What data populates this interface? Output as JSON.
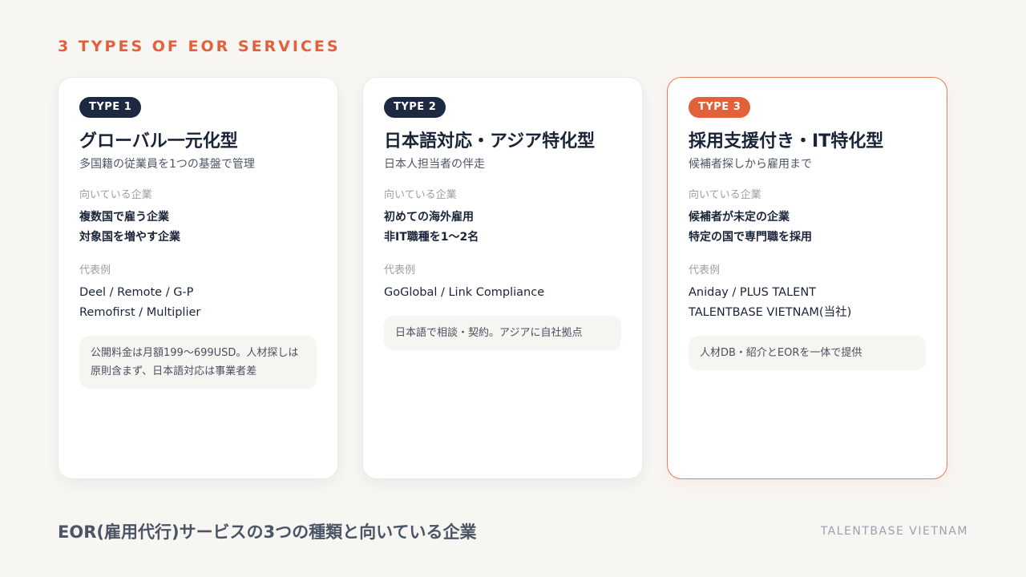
{
  "header": {
    "eyebrow": "3 TYPES OF EOR SERVICES"
  },
  "cards": [
    {
      "badge": "TYPE 1",
      "title": "グローバル一元化型",
      "subtitle": "多国籍の従業員を1つの基盤で管理",
      "fit_label": "向いている企業",
      "fit_items": [
        "複数国で雇う企業",
        "対象国を増やす企業"
      ],
      "examples_label": "代表例",
      "examples": [
        "Deel / Remote / G-P",
        "Remofirst / Multiplier"
      ],
      "note_lines": [
        "公開料金は月額199〜699USD。人材探しは",
        "原則含まず、日本語対応は事業者差"
      ]
    },
    {
      "badge": "TYPE 2",
      "title": "日本語対応・アジア特化型",
      "subtitle": "日本人担当者の伴走",
      "fit_label": "向いている企業",
      "fit_items": [
        "初めての海外雇用",
        "非IT職種を1〜2名"
      ],
      "examples_label": "代表例",
      "examples": [
        "GoGlobal / Link Compliance"
      ],
      "note_lines": [
        "日本語で相談・契約。アジアに自社拠点"
      ]
    },
    {
      "badge": "TYPE 3",
      "title": "採用支援付き・IT特化型",
      "subtitle": "候補者探しから雇用まで",
      "fit_label": "向いている企業",
      "fit_items": [
        "候補者が未定の企業",
        "特定の国で専門職を採用"
      ],
      "examples_label": "代表例",
      "examples": [
        "Aniday / PLUS TALENT",
        "TALENTBASE VIETNAM(当社)"
      ],
      "note_lines": [
        "人材DB・紹介とEORを一体で提供"
      ]
    }
  ],
  "footer": {
    "title": "EOR(雇用代行)サービスの3つの種類と向いている企業",
    "brand": "TALENTBASE VIETNAM"
  },
  "colors": {
    "accent": "#e2603a",
    "navy": "#1c2940",
    "background": "#f8f6f3"
  }
}
